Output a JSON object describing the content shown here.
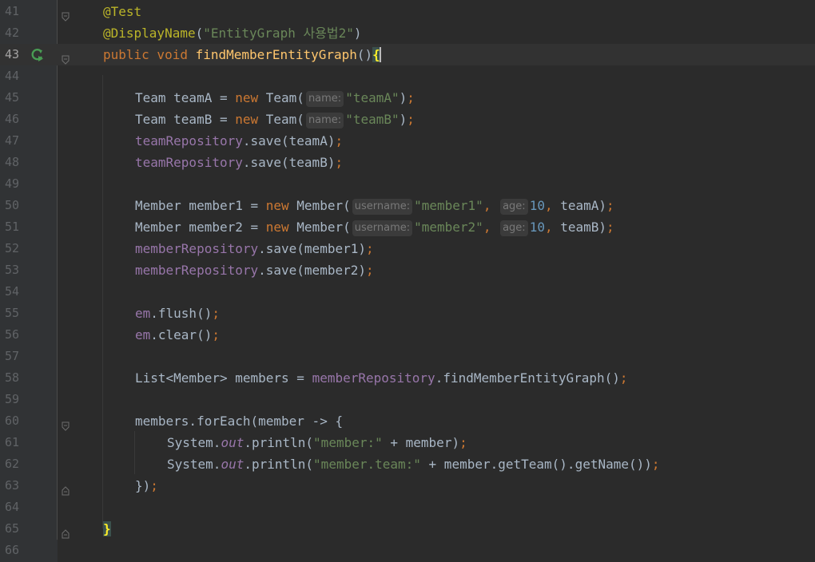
{
  "editor": {
    "lines": [
      {
        "no": "41",
        "tokens": [
          [
            "t-ann",
            "@Test"
          ]
        ]
      },
      {
        "no": "42",
        "tokens": [
          [
            "t-ann",
            "@DisplayName"
          ],
          [
            "t-plain",
            "("
          ],
          [
            "t-str",
            "\"EntityGraph 사용법2\""
          ],
          [
            "t-plain",
            ")"
          ]
        ]
      },
      {
        "no": "43",
        "tokens": [
          [
            "t-kw",
            "public void "
          ],
          [
            "t-fn",
            "findMemberEntityGraph"
          ],
          [
            "t-plain",
            "()"
          ],
          [
            "brace-hl",
            "{"
          ]
        ]
      },
      {
        "no": "44",
        "tokens": []
      },
      {
        "no": "45",
        "tokens": [
          [
            "t-plain",
            "Team teamA = "
          ],
          [
            "t-kw",
            "new "
          ],
          [
            "t-plain",
            "Team("
          ],
          [
            "hint",
            "name:"
          ],
          [
            "t-str",
            "\"teamA\""
          ],
          [
            "t-plain",
            ")"
          ],
          [
            "t-kw",
            ";"
          ]
        ]
      },
      {
        "no": "46",
        "tokens": [
          [
            "t-plain",
            "Team teamB = "
          ],
          [
            "t-kw",
            "new "
          ],
          [
            "t-plain",
            "Team("
          ],
          [
            "hint",
            "name:"
          ],
          [
            "t-str",
            "\"teamB\""
          ],
          [
            "t-plain",
            ")"
          ],
          [
            "t-kw",
            ";"
          ]
        ]
      },
      {
        "no": "47",
        "tokens": [
          [
            "t-field",
            "teamRepository"
          ],
          [
            "t-plain",
            ".save(teamA)"
          ],
          [
            "t-kw",
            ";"
          ]
        ]
      },
      {
        "no": "48",
        "tokens": [
          [
            "t-field",
            "teamRepository"
          ],
          [
            "t-plain",
            ".save(teamB)"
          ],
          [
            "t-kw",
            ";"
          ]
        ]
      },
      {
        "no": "49",
        "tokens": []
      },
      {
        "no": "50",
        "tokens": [
          [
            "t-plain",
            "Member member1 = "
          ],
          [
            "t-kw",
            "new "
          ],
          [
            "t-plain",
            "Member("
          ],
          [
            "hint",
            "username:"
          ],
          [
            "t-str",
            "\"member1\""
          ],
          [
            "t-kw",
            ", "
          ],
          [
            "hint",
            "age:"
          ],
          [
            "t-num",
            "10"
          ],
          [
            "t-kw",
            ", "
          ],
          [
            "t-plain",
            "teamA)"
          ],
          [
            "t-kw",
            ";"
          ]
        ]
      },
      {
        "no": "51",
        "tokens": [
          [
            "t-plain",
            "Member member2 = "
          ],
          [
            "t-kw",
            "new "
          ],
          [
            "t-plain",
            "Member("
          ],
          [
            "hint",
            "username:"
          ],
          [
            "t-str",
            "\"member2\""
          ],
          [
            "t-kw",
            ", "
          ],
          [
            "hint",
            "age:"
          ],
          [
            "t-num",
            "10"
          ],
          [
            "t-kw",
            ", "
          ],
          [
            "t-plain",
            "teamB)"
          ],
          [
            "t-kw",
            ";"
          ]
        ]
      },
      {
        "no": "52",
        "tokens": [
          [
            "t-field",
            "memberRepository"
          ],
          [
            "t-plain",
            ".save(member1)"
          ],
          [
            "t-kw",
            ";"
          ]
        ]
      },
      {
        "no": "53",
        "tokens": [
          [
            "t-field",
            "memberRepository"
          ],
          [
            "t-plain",
            ".save(member2)"
          ],
          [
            "t-kw",
            ";"
          ]
        ]
      },
      {
        "no": "54",
        "tokens": []
      },
      {
        "no": "55",
        "tokens": [
          [
            "t-field",
            "em"
          ],
          [
            "t-plain",
            ".flush()"
          ],
          [
            "t-kw",
            ";"
          ]
        ]
      },
      {
        "no": "56",
        "tokens": [
          [
            "t-field",
            "em"
          ],
          [
            "t-plain",
            ".clear()"
          ],
          [
            "t-kw",
            ";"
          ]
        ]
      },
      {
        "no": "57",
        "tokens": []
      },
      {
        "no": "58",
        "tokens": [
          [
            "t-plain",
            "List<Member> members = "
          ],
          [
            "t-field",
            "memberRepository"
          ],
          [
            "t-plain",
            ".findMemberEntityGraph()"
          ],
          [
            "t-kw",
            ";"
          ]
        ]
      },
      {
        "no": "59",
        "tokens": []
      },
      {
        "no": "60",
        "tokens": [
          [
            "t-plain",
            "members.forEach(member -> {"
          ]
        ]
      },
      {
        "no": "61",
        "tokens": [
          [
            "t-plain",
            "System."
          ],
          [
            "t-static",
            "out"
          ],
          [
            "t-plain",
            ".println("
          ],
          [
            "t-str",
            "\"member:\""
          ],
          [
            "t-plain",
            " + member)"
          ],
          [
            "t-kw",
            ";"
          ]
        ]
      },
      {
        "no": "62",
        "tokens": [
          [
            "t-plain",
            "System."
          ],
          [
            "t-static",
            "out"
          ],
          [
            "t-plain",
            ".println("
          ],
          [
            "t-str",
            "\"member.team:\""
          ],
          [
            "t-plain",
            " + member.getTeam().getName())"
          ],
          [
            "t-kw",
            ";"
          ]
        ]
      },
      {
        "no": "63",
        "tokens": [
          [
            "t-plain",
            "})"
          ],
          [
            "t-kw",
            ";"
          ]
        ]
      },
      {
        "no": "64",
        "tokens": []
      },
      {
        "no": "65",
        "tokens": [
          [
            "brace-hl",
            "}"
          ]
        ]
      },
      {
        "no": "66",
        "tokens": []
      }
    ]
  }
}
